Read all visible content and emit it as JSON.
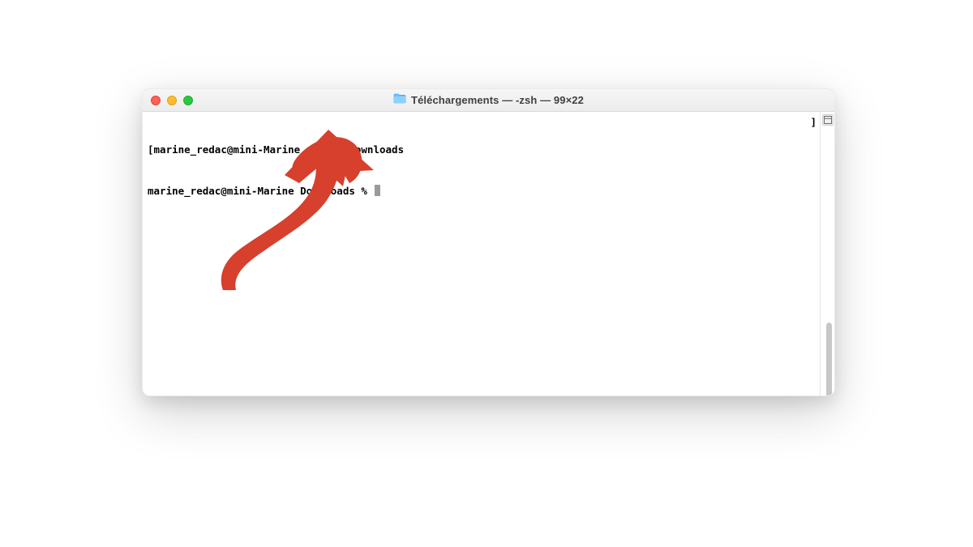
{
  "window": {
    "title": "Téléchargements — -zsh — 99×22"
  },
  "terminal": {
    "lines": [
      {
        "prefix": "[",
        "prompt": "marine_redac@mini-Marine ~ % ",
        "command": "cd Downloads",
        "suffix": ""
      },
      {
        "prefix": "",
        "prompt": "marine_redac@mini-Marine Downloads % ",
        "command": "",
        "suffix": "",
        "cursor": true
      }
    ],
    "right_bracket": "]"
  },
  "annotation": {
    "arrow_color": "#d6402d"
  }
}
